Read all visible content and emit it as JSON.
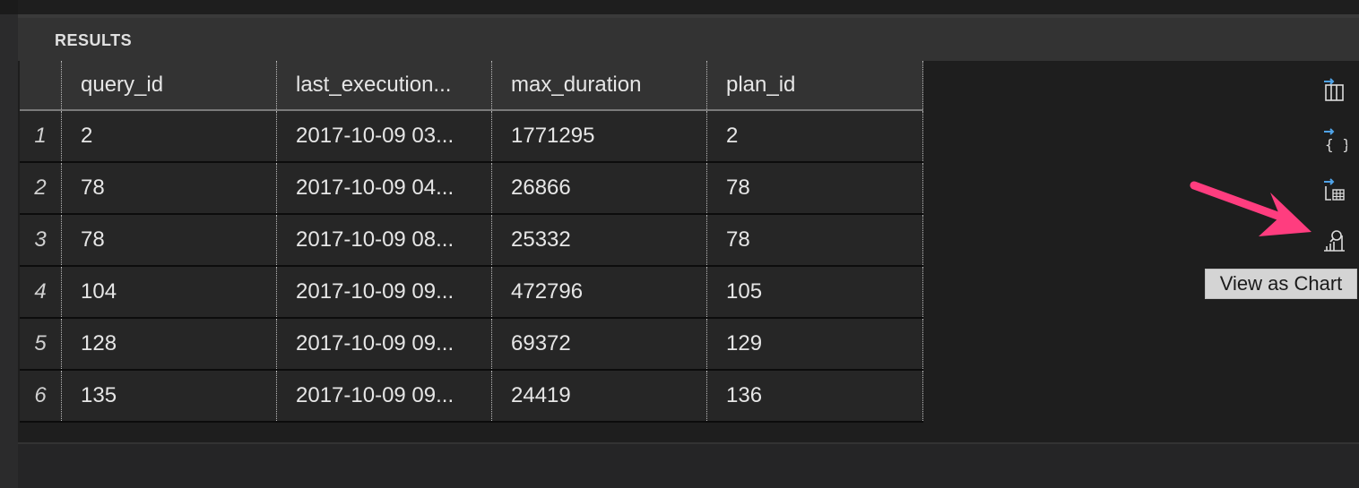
{
  "results": {
    "title": "RESULTS",
    "columns": [
      "query_id",
      "last_execution...",
      "max_duration",
      "plan_id"
    ],
    "rows": [
      {
        "num": "1",
        "query_id": "2",
        "last_execution": "2017-10-09 03...",
        "max_duration": "1771295",
        "plan_id": "2"
      },
      {
        "num": "2",
        "query_id": "78",
        "last_execution": "2017-10-09 04...",
        "max_duration": "26866",
        "plan_id": "78"
      },
      {
        "num": "3",
        "query_id": "78",
        "last_execution": "2017-10-09 08...",
        "max_duration": "25332",
        "plan_id": "78"
      },
      {
        "num": "4",
        "query_id": "104",
        "last_execution": "2017-10-09 09...",
        "max_duration": "472796",
        "plan_id": "105"
      },
      {
        "num": "5",
        "query_id": "128",
        "last_execution": "2017-10-09 09...",
        "max_duration": "69372",
        "plan_id": "129"
      },
      {
        "num": "6",
        "query_id": "135",
        "last_execution": "2017-10-09 09...",
        "max_duration": "24419",
        "plan_id": "136"
      }
    ]
  },
  "toolbar": {
    "icons": [
      "save-as-csv-icon",
      "save-as-json-icon",
      "save-as-excel-icon",
      "view-as-chart-icon"
    ],
    "tooltip": "View as Chart"
  },
  "colors": {
    "background": "#252526",
    "grid_header": "#333333",
    "grid_cell": "#262626",
    "icon_accent": "#4fa3e8",
    "arrow": "#ff3d7f",
    "tooltip_bg": "#d4d4d4"
  }
}
